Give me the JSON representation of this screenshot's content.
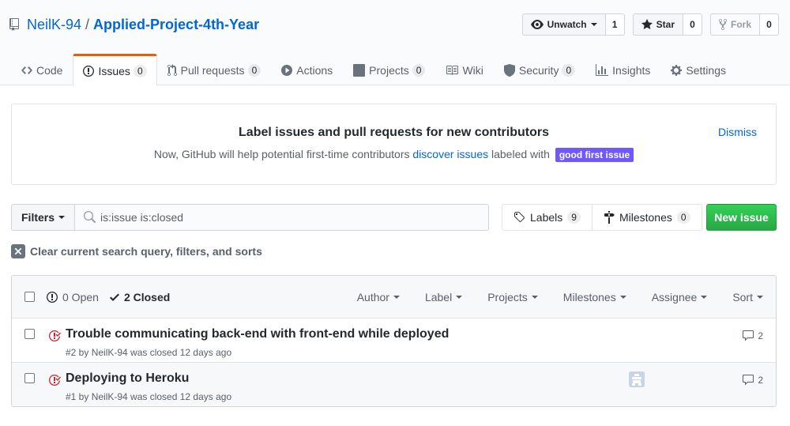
{
  "repo": {
    "owner": "NeilK-94",
    "separator": "/",
    "name": "Applied-Project-4th-Year"
  },
  "actions": {
    "watch": {
      "label": "Unwatch",
      "count": "1"
    },
    "star": {
      "label": "Star",
      "count": "0"
    },
    "fork": {
      "label": "Fork",
      "count": "0"
    }
  },
  "tabs": [
    {
      "label": "Code",
      "icon": "code-icon"
    },
    {
      "label": "Issues",
      "icon": "issue-opened-icon",
      "count": "0"
    },
    {
      "label": "Pull requests",
      "icon": "git-pull-request-icon",
      "count": "0"
    },
    {
      "label": "Actions",
      "icon": "play-icon"
    },
    {
      "label": "Projects",
      "icon": "project-icon",
      "count": "0"
    },
    {
      "label": "Wiki",
      "icon": "book-icon"
    },
    {
      "label": "Security",
      "icon": "shield-icon",
      "count": "0"
    },
    {
      "label": "Insights",
      "icon": "graph-icon"
    },
    {
      "label": "Settings",
      "icon": "gear-icon"
    }
  ],
  "banner": {
    "title": "Label issues and pull requests for new contributors",
    "text_before": "Now, GitHub will help potential first-time contributors ",
    "link": "discover issues",
    "text_after": " labeled with ",
    "label": "good first issue",
    "label_color": "#7057ff",
    "dismiss": "Dismiss"
  },
  "filters": {
    "button": "Filters",
    "query": "is:issue is:closed",
    "labels": {
      "label": "Labels",
      "count": "9"
    },
    "milestones": {
      "label": "Milestones",
      "count": "0"
    },
    "new_issue": "New issue",
    "clear": "Clear current search query, filters, and sorts"
  },
  "list": {
    "open": "0 Open",
    "closed": "2 Closed",
    "sorts": [
      "Author",
      "Label",
      "Projects",
      "Milestones",
      "Assignee",
      "Sort"
    ],
    "issues": [
      {
        "title": "Trouble communicating back-end with front-end while deployed",
        "meta": "#2 by NeilK-94 was closed 12 days ago",
        "comments": "2",
        "has_assignee": false
      },
      {
        "title": "Deploying to Heroku",
        "meta": "#1 by NeilK-94 was closed 12 days ago",
        "comments": "2",
        "has_assignee": true
      }
    ]
  },
  "colors": {
    "link": "#0366d6",
    "green": "#28a745",
    "tab_accent": "#e36209",
    "closed": "#cb2431"
  }
}
